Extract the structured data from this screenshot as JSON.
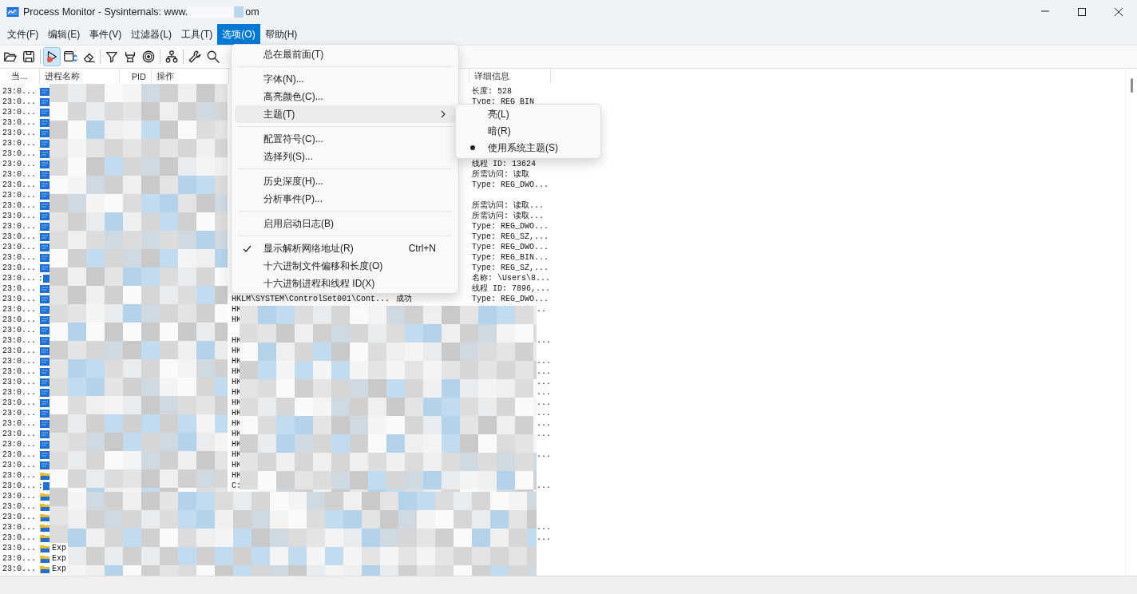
{
  "window": {
    "title_start": "Process Monitor - Sysinternals: www.",
    "title_end": "om"
  },
  "menu_bar": [
    {
      "label": "文件(F)",
      "selected": false
    },
    {
      "label": "编辑(E)",
      "selected": false
    },
    {
      "label": "事件(V)",
      "selected": false
    },
    {
      "label": "过滤器(L)",
      "selected": false
    },
    {
      "label": "工具(T)",
      "selected": false
    },
    {
      "label": "选项(O)",
      "selected": true
    },
    {
      "label": "帮助(H)",
      "selected": false
    }
  ],
  "toolbar": [
    {
      "kind": "open",
      "pressed": false
    },
    {
      "kind": "save",
      "pressed": false
    },
    {
      "kind": "separator"
    },
    {
      "kind": "capture",
      "pressed": true
    },
    {
      "kind": "autoscroll",
      "pressed": false
    },
    {
      "kind": "clear",
      "pressed": false
    },
    {
      "kind": "separator"
    },
    {
      "kind": "filter",
      "pressed": false
    },
    {
      "kind": "highlight",
      "pressed": false
    },
    {
      "kind": "target",
      "pressed": false
    },
    {
      "kind": "separator"
    },
    {
      "kind": "tree",
      "pressed": false
    },
    {
      "kind": "separator"
    },
    {
      "kind": "properties",
      "pressed": false
    },
    {
      "kind": "find",
      "pressed": false
    }
  ],
  "table": {
    "columns": [
      {
        "label": "当..."
      },
      {
        "label": "进程名称"
      },
      {
        "label": "PID"
      },
      {
        "label": "操作"
      },
      {
        "label": "详细信息"
      }
    ],
    "rows": [
      {
        "time": "23:0...",
        "kind": "registry",
        "detail": "长度: 528"
      },
      {
        "time": "23:0...",
        "kind": "registry",
        "detail": "Type: REG_BIN"
      },
      {
        "time": "23:0...",
        "kind": "registry"
      },
      {
        "time": "23:0...",
        "kind": "registry"
      },
      {
        "time": "23:0...",
        "kind": "registry"
      },
      {
        "time": "23:0...",
        "kind": "registry"
      },
      {
        "time": "23:0...",
        "kind": "registry"
      },
      {
        "time": "23:0...",
        "kind": "registry",
        "detail": "线程 ID: 13624"
      },
      {
        "time": "23:0...",
        "kind": "registry",
        "detail": "所需访问: 读取"
      },
      {
        "time": "23:0...",
        "kind": "registry",
        "detail": "Type: REG_DWO..."
      },
      {
        "time": "23:0...",
        "kind": "registry"
      },
      {
        "time": "23:0...",
        "kind": "registry",
        "detail": "所需访问: 读取..."
      },
      {
        "time": "23:0...",
        "kind": "registry",
        "detail": "所需访问: 读取..."
      },
      {
        "time": "23:0...",
        "kind": "registry",
        "detail": "Type: REG_DWO..."
      },
      {
        "time": "23:0...",
        "kind": "registry",
        "detail": "Type: REG_SZ,..."
      },
      {
        "time": "23:0...",
        "kind": "registry",
        "detail": "Type: REG_DWO..."
      },
      {
        "time": "23:0...",
        "kind": "registry",
        "detail": "Type: REG_BIN..."
      },
      {
        "time": "23:0...",
        "kind": "registry",
        "detail": "Type: REG_SZ,..."
      },
      {
        "time": "23:0...",
        "kind": "other",
        "detail": "名称: \\Users\\8..."
      },
      {
        "time": "23:0...",
        "kind": "registry",
        "detail": "线程 ID: 7896,..."
      },
      {
        "time": "23:0...",
        "kind": "registry",
        "path": "HKLM\\SYSTEM\\ControlSet001\\Cont...",
        "result": "成功",
        "detail": "Type: REG_DWO..."
      },
      {
        "time": "23:0...",
        "kind": "registry",
        "path": "HK",
        "detail_tail": ".."
      },
      {
        "time": "23:0...",
        "kind": "registry",
        "path": "HK"
      },
      {
        "time": "23:0...",
        "kind": "registry"
      },
      {
        "time": "23:0...",
        "kind": "registry",
        "path": "HK",
        "detail_tail": "..."
      },
      {
        "time": "23:0...",
        "kind": "registry",
        "path": "HK"
      },
      {
        "time": "23:0...",
        "kind": "registry",
        "path": "HK",
        "detail_tail": "..."
      },
      {
        "time": "23:0...",
        "kind": "registry",
        "path": "HK",
        "detail_tail": "..."
      },
      {
        "time": "23:0...",
        "kind": "registry",
        "path": "HK",
        "detail_tail": "..."
      },
      {
        "time": "23:0...",
        "kind": "registry",
        "path": "HK",
        "detail_tail": "..."
      },
      {
        "time": "23:0...",
        "kind": "registry",
        "path": "HK",
        "detail_tail": "..."
      },
      {
        "time": "23:0...",
        "kind": "registry",
        "path": "HK",
        "detail_tail": "..."
      },
      {
        "time": "23:0...",
        "kind": "registry",
        "path": "HK",
        "detail_tail": "..."
      },
      {
        "time": "23:0...",
        "kind": "registry",
        "path": "HK",
        "detail_tail": "..."
      },
      {
        "time": "23:0...",
        "kind": "registry",
        "path": "HK"
      },
      {
        "time": "23:0...",
        "kind": "registry",
        "path": "HK",
        "detail_tail": "..."
      },
      {
        "time": "23:0...",
        "kind": "registry",
        "path": "HK"
      },
      {
        "time": "23:0...",
        "kind": "file",
        "path": "HK"
      },
      {
        "time": "23:0...",
        "kind": "other",
        "path": "C:",
        "detail_tail": "..."
      },
      {
        "time": "23:0...",
        "kind": "file"
      },
      {
        "time": "23:0...",
        "kind": "file"
      },
      {
        "time": "23:0...",
        "kind": "file"
      },
      {
        "time": "23:0...",
        "kind": "file",
        "detail_tail": "..."
      },
      {
        "time": "23:0...",
        "kind": "file",
        "detail_tail": "..."
      },
      {
        "time": "23:0...",
        "kind": "file",
        "process": "Exp"
      },
      {
        "time": "23:0...",
        "kind": "file",
        "process": "Exp"
      },
      {
        "time": "23:0...",
        "kind": "file",
        "process": "Exp"
      }
    ]
  },
  "options_menu": {
    "items": [
      {
        "kind": "item",
        "label": "总在最前面(T)",
        "checked": false,
        "highlighted": false
      },
      {
        "kind": "separator"
      },
      {
        "kind": "item",
        "label": "字体(N)...",
        "checked": false,
        "highlighted": false
      },
      {
        "kind": "item",
        "label": "高亮颜色(C)...",
        "checked": false,
        "highlighted": false
      },
      {
        "kind": "submenu",
        "label": "主题(T)",
        "checked": false,
        "highlighted": true
      },
      {
        "kind": "separator"
      },
      {
        "kind": "item",
        "label": "配置符号(C)...",
        "checked": false,
        "highlighted": false
      },
      {
        "kind": "item",
        "label": "选择列(S)...",
        "checked": false,
        "highlighted": false
      },
      {
        "kind": "separator"
      },
      {
        "kind": "item",
        "label": "历史深度(H)...",
        "checked": false,
        "highlighted": false
      },
      {
        "kind": "item",
        "label": "分析事件(P)...",
        "checked": false,
        "highlighted": false
      },
      {
        "kind": "separator"
      },
      {
        "kind": "item",
        "label": "启用启动日志(B)",
        "checked": false,
        "highlighted": false
      },
      {
        "kind": "separator"
      },
      {
        "kind": "item",
        "label": "显示解析网络地址(R)",
        "checked": true,
        "highlighted": false,
        "shortcut": "Ctrl+N"
      },
      {
        "kind": "item",
        "label": "十六进制文件偏移和长度(O)",
        "checked": false,
        "highlighted": false
      },
      {
        "kind": "item",
        "label": "十六进制进程和线程 ID(X)",
        "checked": false,
        "highlighted": false
      }
    ]
  },
  "theme_submenu": {
    "items": [
      {
        "label": "亮(L)",
        "selected": false
      },
      {
        "label": "暗(R)",
        "selected": false
      },
      {
        "label": "使用系统主题(S)",
        "selected": true
      }
    ]
  }
}
